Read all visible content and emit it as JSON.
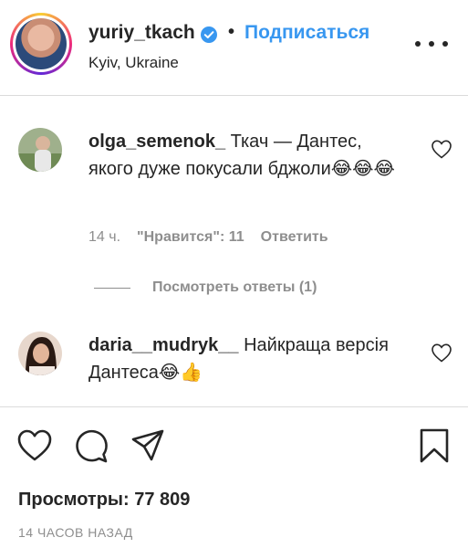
{
  "post": {
    "username": "yuriy_tkach",
    "follow_label": "Подписаться",
    "separator": "•",
    "location": "Kyiv, Ukraine"
  },
  "comments": [
    {
      "username": "olga_semenok_",
      "text": "Ткач — Дантес, якого дуже покусали бджоли😂😂😂",
      "time": "14 ч.",
      "likes": "\"Нравится\": 11",
      "reply_label": "Ответить"
    },
    {
      "username": "daria__mudryk__",
      "text": "Найкраща версія Дантеса😂👍"
    }
  ],
  "replies_toggle": "Посмотреть ответы (1)",
  "stats": {
    "views": "Просмотры: 77 809",
    "posted_ago": "14 ЧАСОВ НАЗАД"
  },
  "colors": {
    "accent": "#3897f0",
    "muted": "#8e8e8e",
    "text": "#262626"
  }
}
